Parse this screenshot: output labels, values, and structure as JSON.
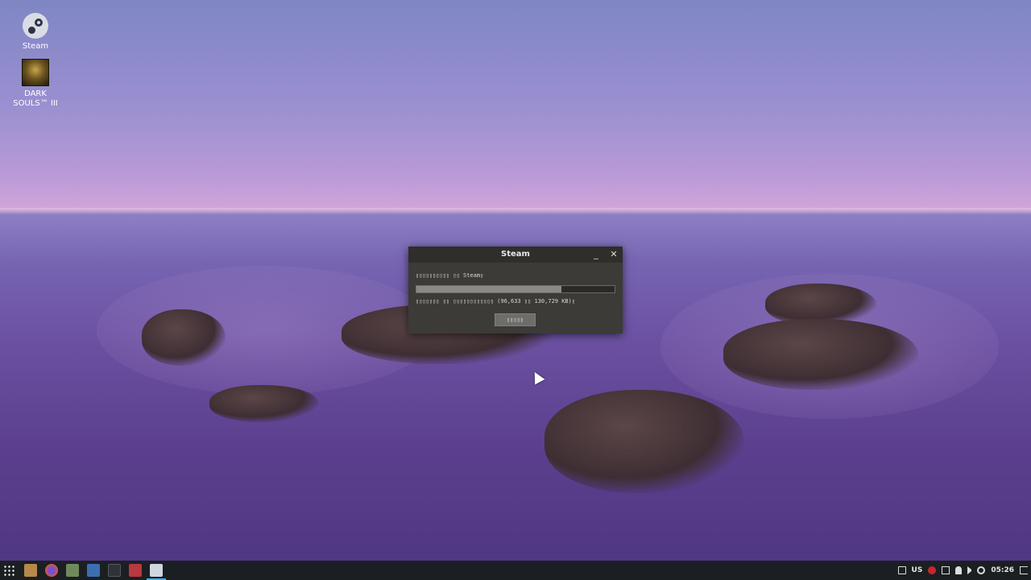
{
  "desktop": {
    "icons": [
      {
        "label": "Steam",
        "icon": "steam-icon"
      },
      {
        "label_line1": "DARK",
        "label_line2": "SOULS™ III",
        "icon": "dark-souls-icon"
      }
    ]
  },
  "dialog": {
    "title": "Steam",
    "minimize_glyph": "_",
    "close_glyph": "✕",
    "message": "▯▯▯▯▯▯▯▯▯▯ ▯▯ Steam▯",
    "progress_fraction": 0.73,
    "status": "▯▯▯▯▯▯▯ ▯▯ ▯▯▯▯▯▯▯▯▯▯▯▯ (96,633 ▯▯ 130,729 KB)▯",
    "cancel_label": "▯▯▯▯▯"
  },
  "taskbar": {
    "apps": [
      "launcher-icon",
      "downloads-icon",
      "firefox-icon",
      "file-manager-icon",
      "media-player-icon",
      "terminal-icon",
      "recorder-icon",
      "steam-window-icon"
    ],
    "tray": {
      "keyboard_layout": "US",
      "clock": "05:26"
    }
  },
  "colors": {
    "dialog_bg": "#3c3b37",
    "titlebar_bg": "#2f2e2b",
    "taskbar_bg": "#1c1f22",
    "accent": "#3daee9"
  }
}
